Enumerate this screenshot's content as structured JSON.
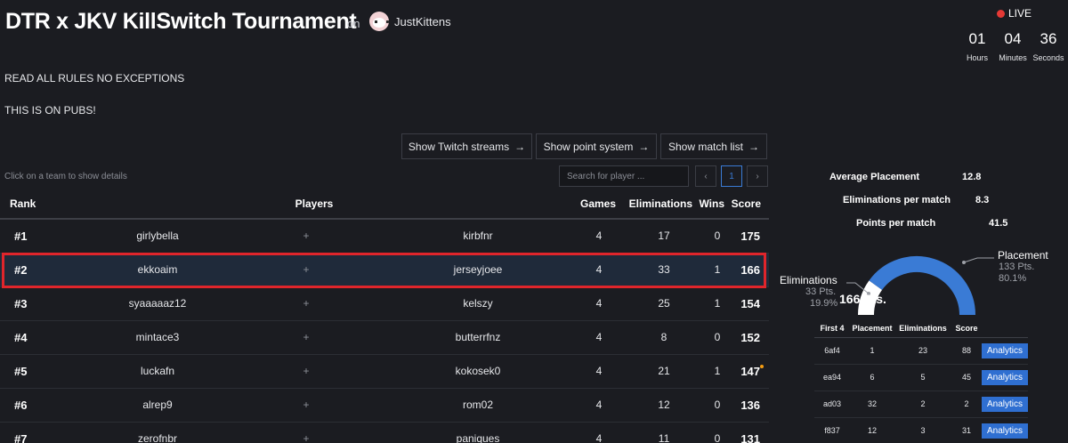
{
  "header": {
    "title": "DTR x JKV KillSwitch Tournament",
    "on_label": "on",
    "host_name": "JustKittens",
    "live_label": "LIVE",
    "timer": [
      {
        "value": "01",
        "label": "Hours"
      },
      {
        "value": "04",
        "label": "Minutes"
      },
      {
        "value": "36",
        "label": "Seconds"
      }
    ]
  },
  "description": [
    "READ ALL RULES NO EXCEPTIONS",
    "THIS IS ON PUBS!"
  ],
  "buttons": {
    "twitch": "Show Twitch streams",
    "points": "Show point system",
    "matches": "Show match list",
    "arrow": "→"
  },
  "hint": "Click on a team to show details",
  "search": {
    "placeholder": "Search for player ..."
  },
  "pagination": {
    "prev": "‹",
    "current": "1",
    "next": "›"
  },
  "leaderboard": {
    "columns": {
      "rank": "Rank",
      "players": "Players",
      "games": "Games",
      "eliminations": "Eliminations",
      "wins": "Wins",
      "score": "Score"
    },
    "plus": "+",
    "rows": [
      {
        "rank": "#1",
        "p1": "girlybella",
        "p2": "kirbfnr",
        "games": "4",
        "elims": "17",
        "wins": "0",
        "score": "175"
      },
      {
        "rank": "#2",
        "p1": "ekkoaim",
        "p2": "jerseyjoee",
        "games": "4",
        "elims": "33",
        "wins": "1",
        "score": "166"
      },
      {
        "rank": "#3",
        "p1": "syaaaaaz12",
        "p2": "kelszy",
        "games": "4",
        "elims": "25",
        "wins": "1",
        "score": "154"
      },
      {
        "rank": "#4",
        "p1": "mintace3",
        "p2": "butterrfnz",
        "games": "4",
        "elims": "8",
        "wins": "0",
        "score": "152"
      },
      {
        "rank": "#5",
        "p1": "luckafn",
        "p2": "kokosek0",
        "games": "4",
        "elims": "21",
        "wins": "1",
        "score": "147"
      },
      {
        "rank": "#6",
        "p1": "alrep9",
        "p2": "rom02",
        "games": "4",
        "elims": "12",
        "wins": "0",
        "score": "136"
      },
      {
        "rank": "#7",
        "p1": "zerofnbr",
        "p2": "paniques",
        "games": "4",
        "elims": "11",
        "wins": "0",
        "score": "131"
      }
    ]
  },
  "details": {
    "stats": [
      {
        "label": "Average Placement",
        "value": "12.8"
      },
      {
        "label": "Eliminations per match",
        "value": "8.3"
      },
      {
        "label": "Points per match",
        "value": "41.5"
      }
    ],
    "gauge": {
      "total": "166 Pts.",
      "eliminations": {
        "label": "Eliminations",
        "points": "33 Pts.",
        "percent": "19.9%",
        "fraction": 0.199
      },
      "placement": {
        "label": "Placement",
        "points": "133 Pts.",
        "percent": "80.1%",
        "fraction": 0.801
      },
      "colors": {
        "placement": "#3a7bd5",
        "eliminations": "#ffffff"
      }
    },
    "matches": {
      "columns": [
        "First 4",
        "Placement",
        "Eliminations",
        "Score",
        ""
      ],
      "button_label": "Analytics",
      "rows": [
        {
          "id": "6af4",
          "placement": "1",
          "elims": "23",
          "score": "88"
        },
        {
          "id": "ea94",
          "placement": "6",
          "elims": "5",
          "score": "45"
        },
        {
          "id": "ad03",
          "placement": "32",
          "elims": "2",
          "score": "2"
        },
        {
          "id": "f837",
          "placement": "12",
          "elims": "3",
          "score": "31"
        }
      ]
    }
  }
}
